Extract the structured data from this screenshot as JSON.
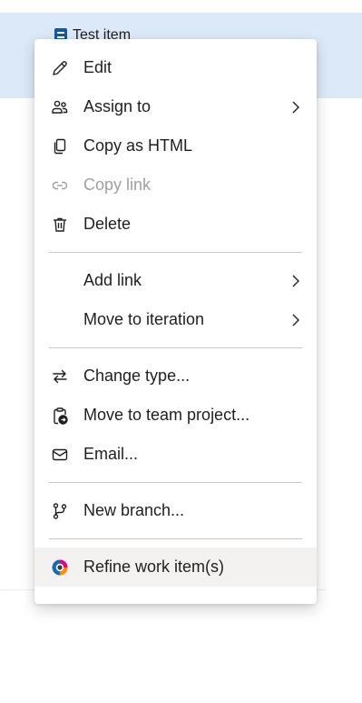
{
  "background": {
    "row_title": "Test item"
  },
  "menu": {
    "items": [
      {
        "label": "Edit",
        "icon": "pencil-icon",
        "enabled": true
      },
      {
        "label": "Assign to",
        "icon": "people-icon",
        "enabled": true,
        "submenu": true
      },
      {
        "label": "Copy as HTML",
        "icon": "copy-icon",
        "enabled": true
      },
      {
        "label": "Copy link",
        "icon": "link-icon",
        "enabled": false
      },
      {
        "label": "Delete",
        "icon": "trash-icon",
        "enabled": true
      },
      {
        "label": "Add link",
        "enabled": true,
        "submenu": true
      },
      {
        "label": "Move to iteration",
        "enabled": true,
        "submenu": true
      },
      {
        "label": "Change type...",
        "icon": "swap-arrows-icon",
        "enabled": true
      },
      {
        "label": "Move to team project...",
        "icon": "clipboard-move-icon",
        "enabled": true
      },
      {
        "label": "Email...",
        "icon": "mail-icon",
        "enabled": true
      },
      {
        "label": "New branch...",
        "icon": "branch-icon",
        "enabled": true
      },
      {
        "label": "Refine work item(s)",
        "icon": "copilot-icon",
        "enabled": true,
        "highlighted": true
      }
    ]
  },
  "colors": {
    "row_highlight": "#dce9f8",
    "text": "#201f1e",
    "disabled_text": "#a19f9d",
    "separator": "#c8c6c4",
    "hover": "#f3f2f1",
    "work_item_icon": "#0f5aa8"
  }
}
